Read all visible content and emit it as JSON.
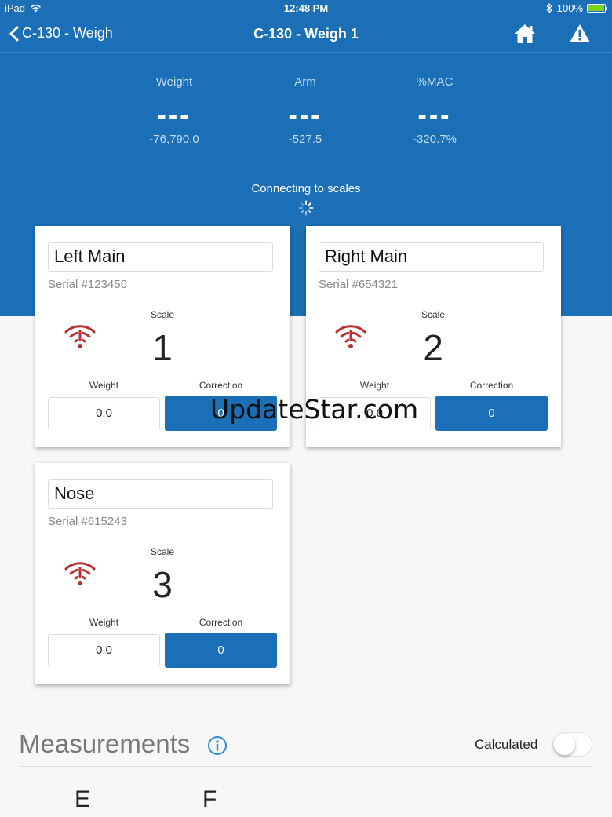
{
  "status_bar": {
    "device": "iPad",
    "time": "12:48 PM",
    "battery": "100%"
  },
  "nav": {
    "back_label": "C-130 - Weigh",
    "title": "C-130 - Weigh 1"
  },
  "summary": {
    "metrics": [
      {
        "label": "Weight",
        "value": "---",
        "sub": "-76,790.0"
      },
      {
        "label": "Arm",
        "value": "---",
        "sub": "-527.5"
      },
      {
        "label": "%MAC",
        "value": "---",
        "sub": "-320.7%"
      }
    ],
    "connecting_text": "Connecting to scales"
  },
  "scales": [
    {
      "name": "Left Main",
      "serial": "Serial #123456",
      "scale_label": "Scale",
      "scale_number": "1",
      "weight_label": "Weight",
      "weight": "0.0",
      "correction_label": "Correction",
      "correction": "0"
    },
    {
      "name": "Right Main",
      "serial": "Serial #654321",
      "scale_label": "Scale",
      "scale_number": "2",
      "weight_label": "Weight",
      "weight": "0.0",
      "correction_label": "Correction",
      "correction": "0"
    },
    {
      "name": "Nose",
      "serial": "Serial #615243",
      "scale_label": "Scale",
      "scale_number": "3",
      "weight_label": "Weight",
      "weight": "0.0",
      "correction_label": "Correction",
      "correction": "0"
    }
  ],
  "watermark": "UpdateStar.com",
  "measurements": {
    "title": "Measurements",
    "calculated_label": "Calculated",
    "calculated_on": false,
    "columns": [
      "E",
      "F"
    ]
  },
  "colors": {
    "primary": "#1a6fb6",
    "signal_red": "#b83232",
    "info_blue": "#2a8ae0"
  },
  "icons": [
    "wifi-icon",
    "bluetooth-icon",
    "back-chevron-icon",
    "home-icon",
    "warning-icon",
    "spinner-icon",
    "scale-signal-icon",
    "info-icon"
  ]
}
